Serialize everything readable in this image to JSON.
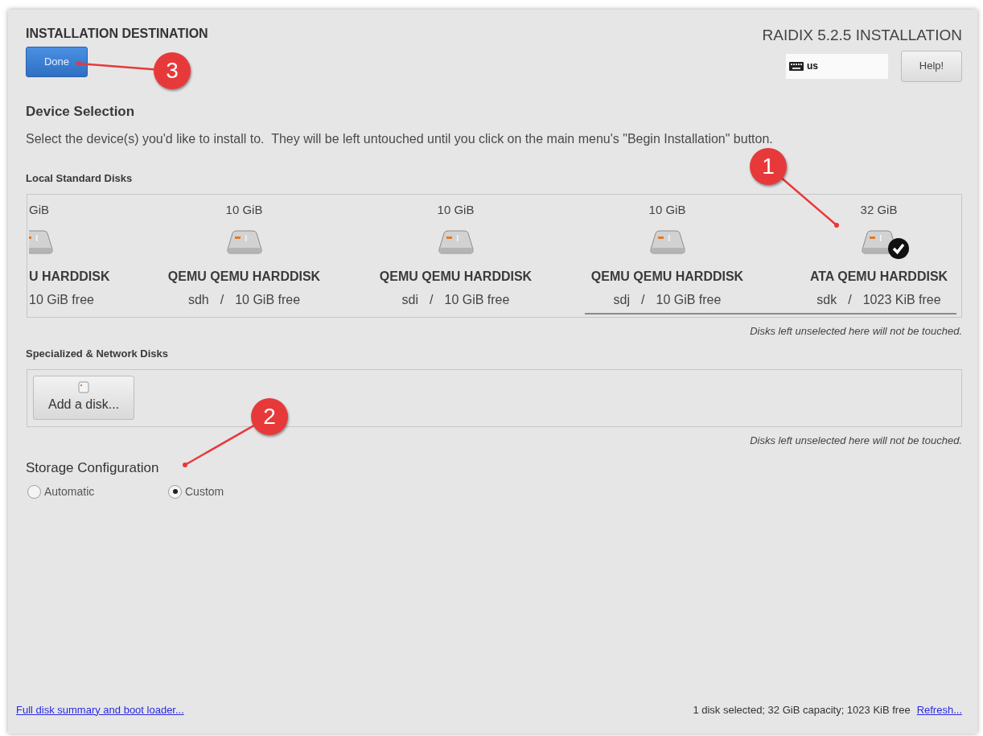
{
  "header": {
    "title": "INSTALLATION DESTINATION",
    "done_button": "Done",
    "product": "RAIDIX 5.2.5 INSTALLATION",
    "keyboard_layout": "us",
    "help_button": "Help!"
  },
  "device_selection": {
    "heading": "Device Selection",
    "description": "Select the device(s) you'd like to install to.  They will be left untouched until you click on the main menu's \"Begin Installation\" button."
  },
  "local_disks": {
    "heading": "Local Standard Disks",
    "disks": [
      {
        "kind": "cut",
        "size": "GiB",
        "model": "U HARDDISK",
        "free": "10 GiB free",
        "selected": false
      },
      {
        "kind": "full",
        "size": "10 GiB",
        "model": "QEMU QEMU HARDDISK",
        "device": "sdh",
        "separator": "/",
        "free": "10 GiB free",
        "selected": false
      },
      {
        "kind": "full",
        "size": "10 GiB",
        "model": "QEMU QEMU HARDDISK",
        "device": "sdi",
        "separator": "/",
        "free": "10 GiB free",
        "selected": false
      },
      {
        "kind": "full",
        "size": "10 GiB",
        "model": "QEMU QEMU HARDDISK",
        "device": "sdj",
        "separator": "/",
        "free": "10 GiB free",
        "selected": false
      },
      {
        "kind": "full",
        "size": "32 GiB",
        "model": "ATA QEMU HARDDISK",
        "device": "sdk",
        "separator": "/",
        "free": "1023 KiB free",
        "selected": true
      }
    ],
    "note": "Disks left unselected here will not be touched."
  },
  "specialized_disks": {
    "heading": "Specialized & Network Disks",
    "add_button": "Add a disk...",
    "note": "Disks left unselected here will not be touched."
  },
  "storage_configuration": {
    "heading": "Storage Configuration",
    "options": [
      {
        "label": "Automatic",
        "selected": false
      },
      {
        "label": "Custom",
        "selected": true
      }
    ]
  },
  "footer": {
    "summary_link": "Full disk summary and boot loader...",
    "status": "1 disk selected; 32 GiB capacity; 1023 KiB free",
    "refresh_link": "Refresh..."
  },
  "annotations": [
    {
      "number": "1"
    },
    {
      "number": "2"
    },
    {
      "number": "3"
    }
  ]
}
